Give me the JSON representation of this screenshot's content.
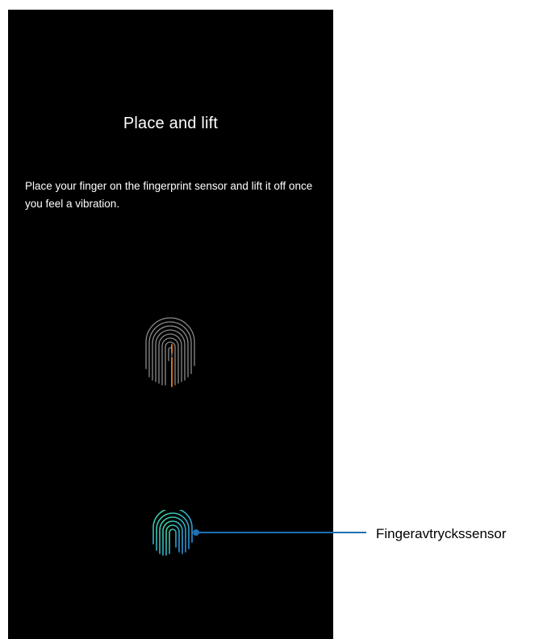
{
  "screen": {
    "title": "Place and lift",
    "description": "Place your finger on the fingerprint sensor and lift it off once you feel a vibration."
  },
  "illustration": {
    "icon": "fingerprint-progress-icon",
    "ridge_color": "#8a8a8a",
    "progress_color": "#e87a2a"
  },
  "sensor": {
    "icon": "fingerprint-sensor-icon",
    "gradient_colors": [
      "#3fd6a6",
      "#2a8bdc"
    ]
  },
  "callout": {
    "label": "Fingeravtryckssensor",
    "line_color": "#1e6fb5"
  }
}
